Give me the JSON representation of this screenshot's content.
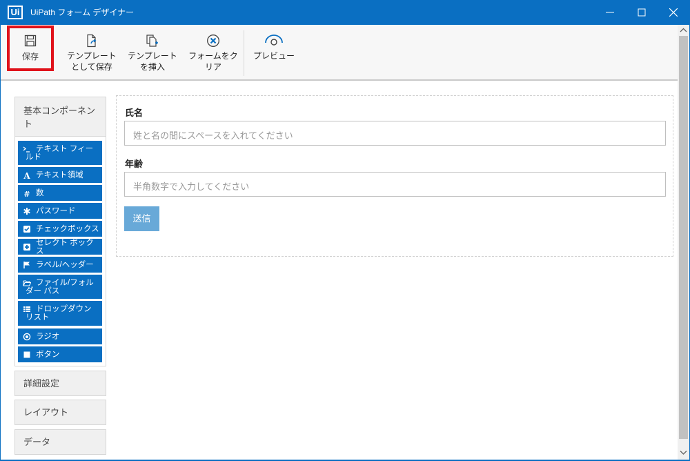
{
  "window": {
    "logo": "Ui",
    "title": "UiPath フォーム デザイナー",
    "colors": {
      "titlebar": "#0a6fc2",
      "highlight": "#e0121b",
      "component": "#0a6fc2",
      "submit": "#68a9d8"
    }
  },
  "toolbar": {
    "save_label": "保存",
    "save_template_label": "テンプレート\nとして保存",
    "insert_template_label": "テンプレート\nを挿入",
    "clear_form_label": "フォームをク\nリア",
    "preview_label": "プレビュー"
  },
  "sidebar": {
    "basic_title": "基本コンポーネント",
    "components": [
      {
        "label": "テキスト フィールド",
        "icon": "prompt-icon"
      },
      {
        "label": "テキスト領域",
        "icon": "font-a-icon"
      },
      {
        "label": "数",
        "icon": "hash-icon"
      },
      {
        "label": "パスワード",
        "icon": "asterisk-icon"
      },
      {
        "label": "チェックボックス",
        "icon": "checkbox-icon"
      },
      {
        "label": "セレクト ボックス",
        "icon": "plus-square-icon"
      },
      {
        "label": "ラベル/ヘッダー",
        "icon": "flag-icon"
      },
      {
        "label": "ファイル/フォルダー パス",
        "icon": "folder-open-icon"
      },
      {
        "label": "ドロップダウン リスト",
        "icon": "list-icon"
      },
      {
        "label": "ラジオ",
        "icon": "radio-icon"
      },
      {
        "label": "ボタン",
        "icon": "stop-square-icon"
      }
    ],
    "advanced_title": "詳細設定",
    "layout_title": "レイアウト",
    "data_title": "データ"
  },
  "form": {
    "name_label": "氏名",
    "name_placeholder": "姓と名の間にスペースを入れてください",
    "age_label": "年齢",
    "age_placeholder": "半角数字で入力してください",
    "submit_label": "送信"
  }
}
